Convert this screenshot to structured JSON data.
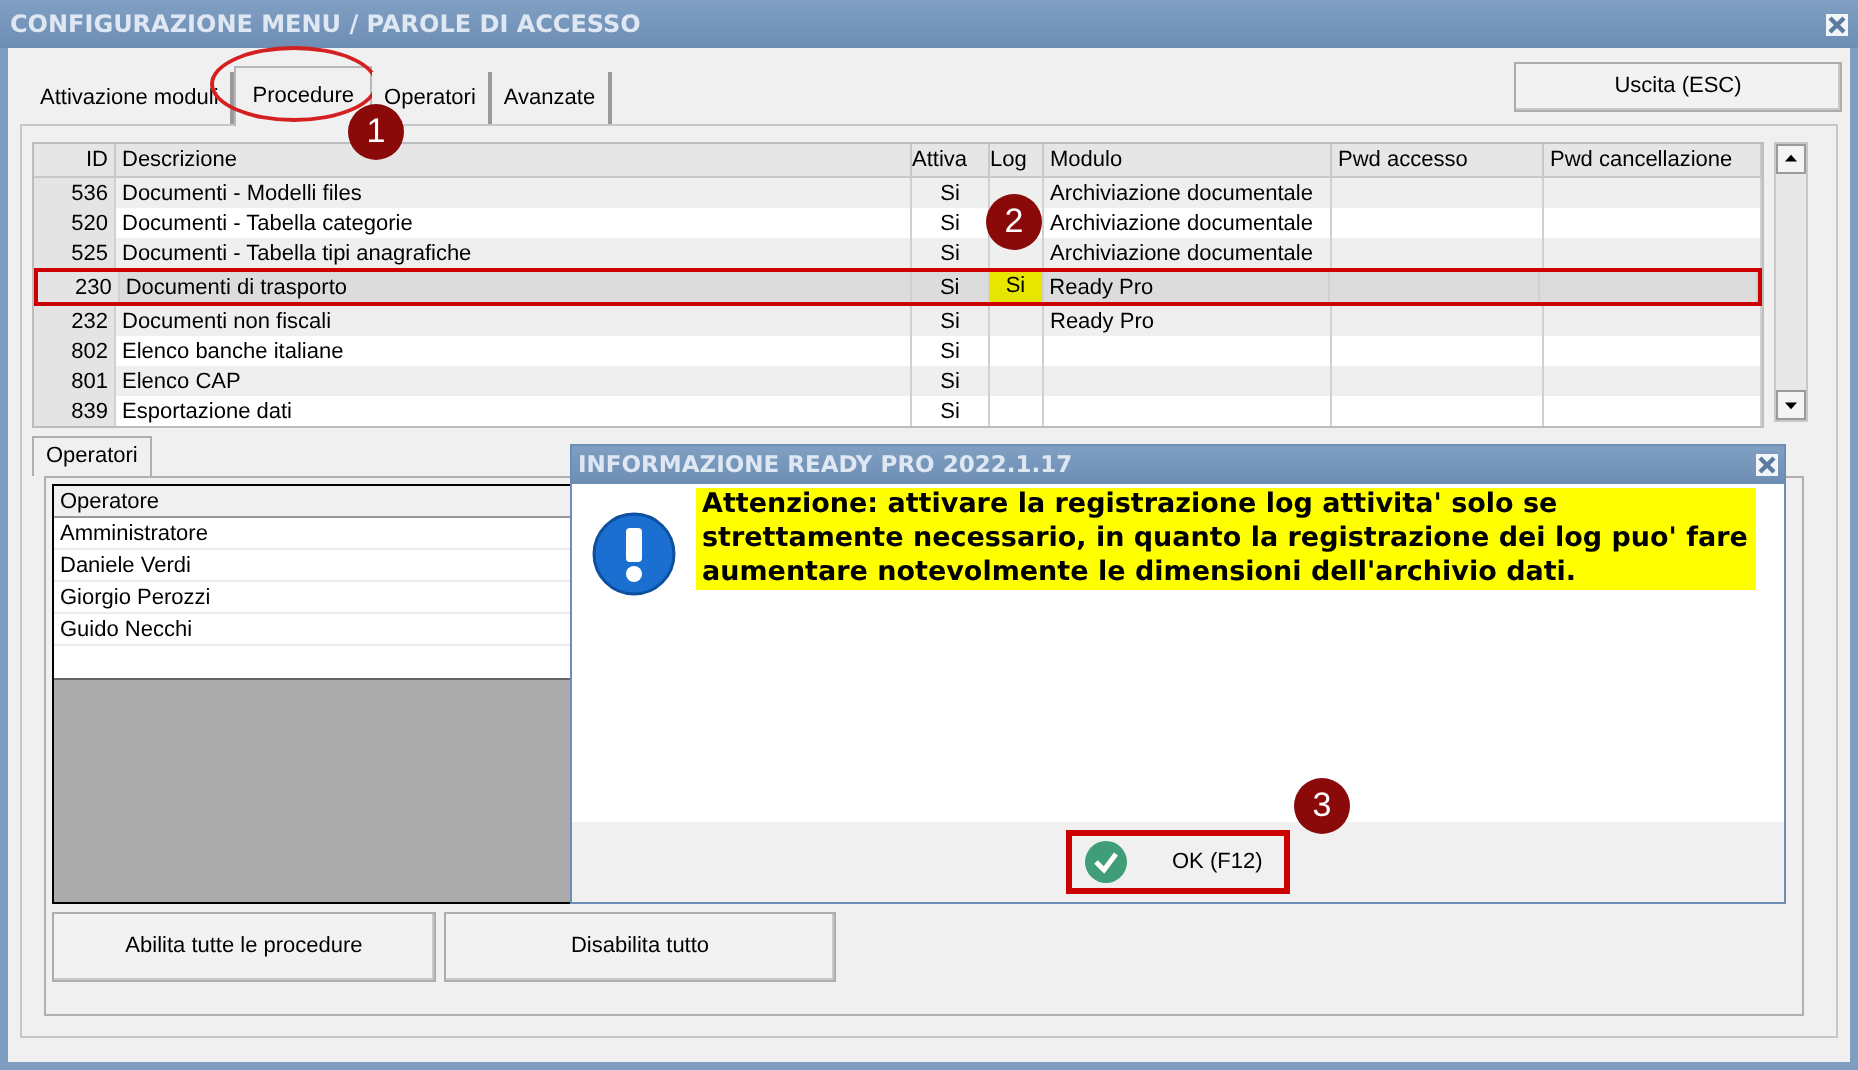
{
  "window": {
    "title": "CONFIGURAZIONE MENU / PAROLE DI ACCESSO"
  },
  "tabs": [
    {
      "label": "Attivazione moduli",
      "selected": false,
      "circled": false
    },
    {
      "label": "Procedure",
      "selected": true,
      "circled": true
    },
    {
      "label": "Operatori",
      "selected": false,
      "circled": false
    },
    {
      "label": "Avanzate",
      "selected": false,
      "circled": false
    }
  ],
  "exit_button": "Uscita (ESC)",
  "table": {
    "columns": [
      "ID",
      "Descrizione",
      "Attiva",
      "Log",
      "Modulo",
      "Pwd accesso",
      "Pwd cancellazione"
    ],
    "rows": [
      {
        "id": "536",
        "descrizione": "Documenti - Modelli files",
        "attiva": "Si",
        "modulo": "Archiviazione documentale",
        "selected": false,
        "boxed": false
      },
      {
        "id": "520",
        "descrizione": "Documenti - Tabella categorie",
        "attiva": "Si",
        "modulo": "Archiviazione documentale",
        "selected": false,
        "boxed": false
      },
      {
        "id": "525",
        "descrizione": "Documenti - Tabella tipi anagrafiche",
        "attiva": "Si",
        "modulo": "Archiviazione documentale",
        "selected": false,
        "boxed": false
      },
      {
        "id": "230",
        "descrizione": "Documenti di trasporto",
        "attiva": "Si",
        "log": "Si",
        "log_highlighted": true,
        "modulo": "Ready Pro",
        "selected": true,
        "boxed": true
      },
      {
        "id": "232",
        "descrizione": "Documenti non fiscali",
        "attiva": "Si",
        "modulo": "Ready Pro",
        "selected": false,
        "boxed": false
      },
      {
        "id": "802",
        "descrizione": "Elenco banche italiane",
        "attiva": "Si",
        "selected": false,
        "boxed": false
      },
      {
        "id": "801",
        "descrizione": "Elenco CAP",
        "attiva": "Si",
        "selected": false,
        "boxed": false
      },
      {
        "id": "839",
        "descrizione": "Esportazione dati",
        "attiva": "Si",
        "selected": false,
        "boxed": false
      }
    ]
  },
  "operators_tab": {
    "label": "Operatori",
    "selected": true
  },
  "operators_table": {
    "columns": [
      "Operatore"
    ],
    "rows": [
      "Amministratore",
      "Daniele Verdi",
      "Giorgio Perozzi",
      "Guido Necchi"
    ]
  },
  "buttons": [
    "Abilita tutte le procedure",
    "Disabilita tutto"
  ],
  "dialog": {
    "title": "INFORMAZIONE READY PRO 2022.1.17",
    "message": "Attenzione: attivare la registrazione log attivita' solo se strettamente necessario, in quanto la registrazione dei log puo' fare aumentare notevolmente le dimensioni dell'archivio dati.",
    "ok_button": {
      "label": "OK (F12)",
      "boxed": true
    }
  },
  "annotations": [
    {
      "label": "1"
    },
    {
      "label": "2"
    },
    {
      "label": "3"
    }
  ]
}
